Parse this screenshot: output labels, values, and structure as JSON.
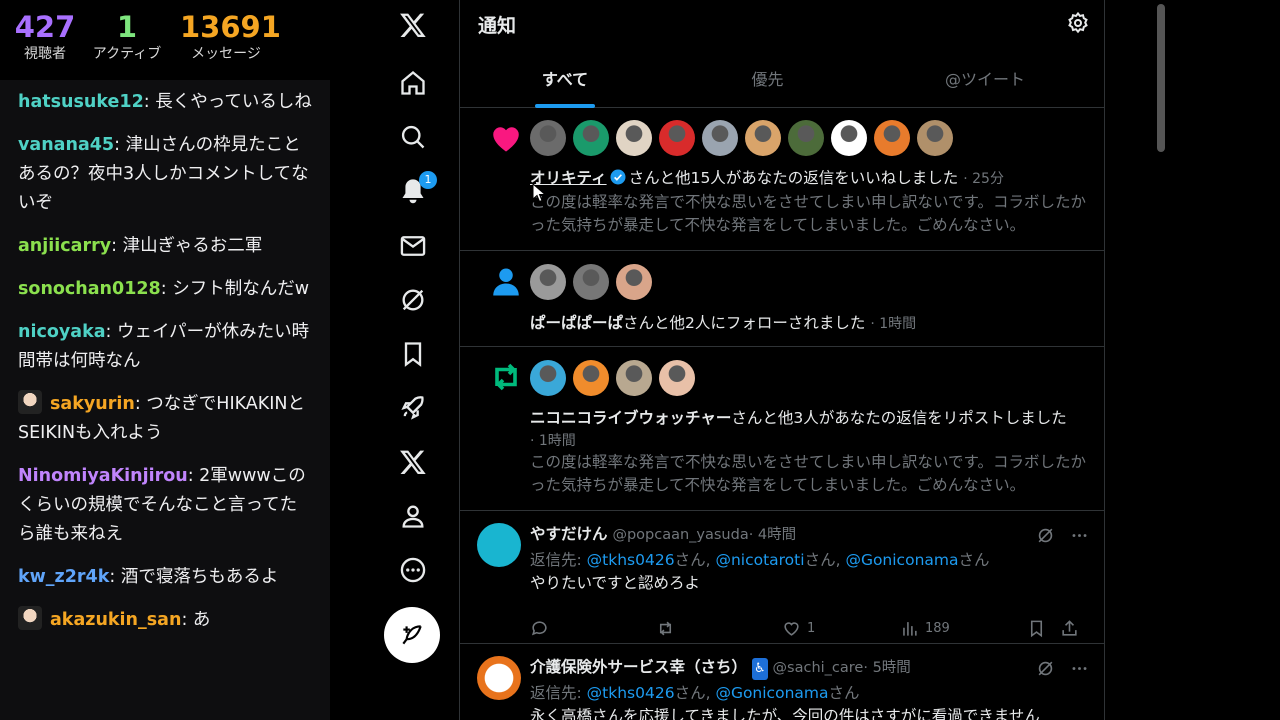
{
  "stats": {
    "viewers": {
      "value": "427",
      "label": "視聴者"
    },
    "active": {
      "value": "1",
      "label": "アクティブ"
    },
    "messages": {
      "value": "13691",
      "label": "メッセージ"
    }
  },
  "chat": [
    {
      "user": "hatsusuke12",
      "color": "#4fd1c5",
      "text": "長くやっているしね",
      "avatar": false
    },
    {
      "user": "vanana45",
      "color": "#4fd1c5",
      "text": "津山さんの枠見たことあるの？夜中3人しかコメントしてないぞ",
      "avatar": false
    },
    {
      "user": "anjiicarry",
      "color": "#8be04e",
      "text": "津山ぎゃるお二軍",
      "avatar": false
    },
    {
      "user": "sonochan0128",
      "color": "#8be04e",
      "text": "シフト制なんだw",
      "avatar": false
    },
    {
      "user": "nicoyaka",
      "color": "#4fd1c5",
      "text": "ウェイパーが休みたい時間帯は何時なん",
      "avatar": false
    },
    {
      "user": "sakyurin",
      "color": "#f5a623",
      "text": "つなぎでHIKAKINとSEIKINも入れよう",
      "avatar": true
    },
    {
      "user": "NinomiyaKinjirou",
      "color": "#c084fc",
      "text": "2軍wwwこのくらいの規模でそんなこと言ってたら誰も来ねえ",
      "avatar": false
    },
    {
      "user": "kw_z2r4k",
      "color": "#60a5fa",
      "text": "酒で寝落ちもあるよ",
      "avatar": false
    },
    {
      "user": "akazukin_san",
      "color": "#f5a623",
      "text": "あ",
      "avatar": true
    }
  ],
  "nav": {
    "items": [
      {
        "name": "x-logo-icon"
      },
      {
        "name": "home-icon"
      },
      {
        "name": "search-icon"
      },
      {
        "name": "notifications-icon"
      },
      {
        "name": "messages-icon"
      },
      {
        "name": "grok-icon"
      },
      {
        "name": "bookmarks-icon"
      },
      {
        "name": "rocket-icon"
      },
      {
        "name": "premium-x-icon"
      },
      {
        "name": "profile-icon"
      },
      {
        "name": "more-icon"
      }
    ],
    "notification_badge": "1"
  },
  "header": {
    "title": "通知",
    "tabs": [
      "すべて",
      "優先",
      "@ツイート"
    ]
  },
  "notifications": {
    "likes": {
      "actor": "オリキティ",
      "text": "さんと他15人があなたの返信をいいねしました",
      "time": "· 25分",
      "preview": "この度は軽率な発言で不快な思いをさせてしまい申し訳ないです。コラボしたかった気持ちが暴走して不快な発言をしてしまいました。ごめんなさい。",
      "avatar_colors": [
        "#6b6b6b",
        "#1a9a6b",
        "#e0d4c4",
        "#d82b2b",
        "#9aa4b0",
        "#d9a46a",
        "#4c6b3a",
        "#ffffff",
        "#e87b2c",
        "#b0906a"
      ]
    },
    "follows": {
      "actor": "ぱーぱぱーぱ",
      "text": "さんと他2人にフォローされました",
      "time": "· 1時間",
      "avatar_colors": [
        "#9a9a9a",
        "#777777",
        "#d9a58a"
      ]
    },
    "reposts": {
      "actor": "ニコニコライブウォッチャー",
      "text": "さんと他3人があなたの返信をリポストしました",
      "time": "· 1時間",
      "preview": "この度は軽率な発言で不快な思いをさせてしまい申し訳ないです。コラボしたかった気持ちが暴走して不快な発言をしてしまいました。ごめんなさい。",
      "avatar_colors": [
        "#3aa8d8",
        "#f08c2c",
        "#b8a890",
        "#e8c0a8"
      ]
    }
  },
  "tweets": [
    {
      "name": "やすだけん",
      "handle": "@popcaan_yasuda",
      "time": "· 4時間",
      "reply_prefix": "返信先: ",
      "mentions": [
        "@tkhs0426",
        "@nicotaroti",
        "@Goniconama"
      ],
      "san": "さん",
      "sep": ", ",
      "body": "やりたいですと認めろよ",
      "likes": "1",
      "views": "189",
      "avatar_color": "#19b5d0"
    },
    {
      "name": "介護保険外サービス幸（さち）",
      "badge": "♿",
      "handle": "@sachi_care",
      "time": "· 5時間",
      "reply_prefix": "返信先: ",
      "mentions": [
        "@tkhs0426",
        "@Goniconama"
      ],
      "san": "さん",
      "sep": ", ",
      "body": "永く高橋さんを応援してきましたが、今回の件はさすがに看過できません",
      "avatar_color": "#e8731c"
    }
  ],
  "colors": {
    "accent": "#1d9bf0",
    "like": "#f91880",
    "repost": "#00ba7c"
  }
}
